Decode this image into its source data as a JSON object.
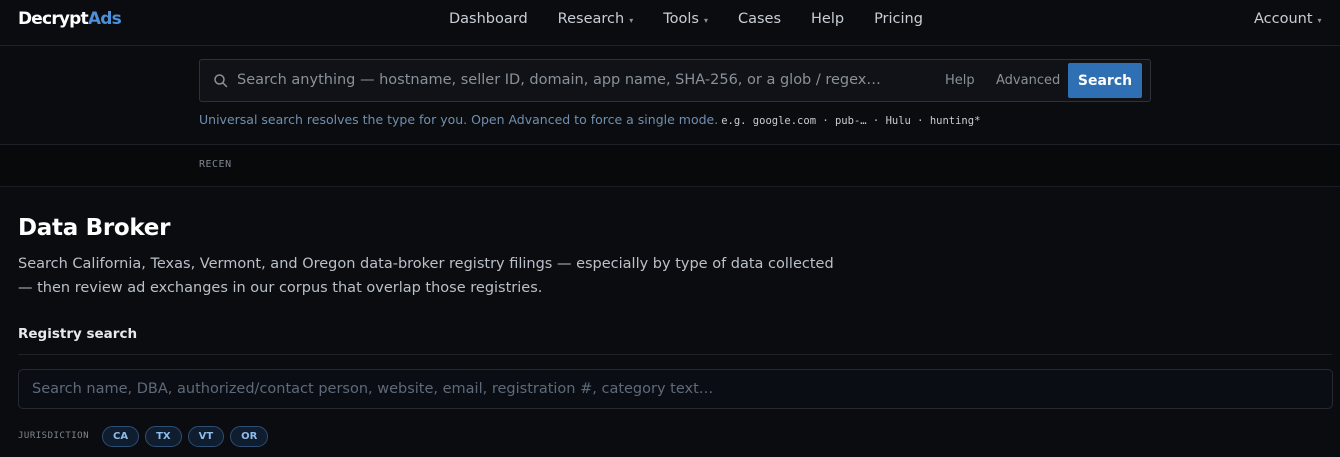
{
  "brand": {
    "name_part1": "Decrypt",
    "name_part2": "Ads",
    "accent_color": "#4b90d9"
  },
  "nav": {
    "items": [
      {
        "label": "Dashboard",
        "has_dropdown": false
      },
      {
        "label": "Research",
        "has_dropdown": true
      },
      {
        "label": "Tools",
        "has_dropdown": true
      },
      {
        "label": "Cases",
        "has_dropdown": false
      },
      {
        "label": "Help",
        "has_dropdown": false
      },
      {
        "label": "Pricing",
        "has_dropdown": false
      }
    ],
    "account_label": "Account",
    "caret": "▾"
  },
  "search": {
    "placeholder": "Search anything — hostname, seller ID, domain, app name, SHA-256, or a glob / regex…",
    "help_label": "Help",
    "advanced_label": "Advanced",
    "button_label": "Search",
    "hint": "Universal search resolves the type for you. Open Advanced to force a single mode.",
    "examples": "e.g. google.com · pub-… · Hulu · hunting*"
  },
  "recent": {
    "label": "RECEN"
  },
  "page": {
    "title": "Data Broker",
    "description": "Search California, Texas, Vermont, and Oregon data-broker registry filings — especially by type of data collected — then review ad exchanges in our corpus that overlap those registries."
  },
  "registry": {
    "section_title": "Registry search",
    "placeholder": "Search name, DBA, authorized/contact person, website, email, registration #, category text…",
    "jurisdiction_label": "JURISDICTION",
    "jurisdictions": [
      "CA",
      "TX",
      "VT",
      "OR"
    ]
  }
}
